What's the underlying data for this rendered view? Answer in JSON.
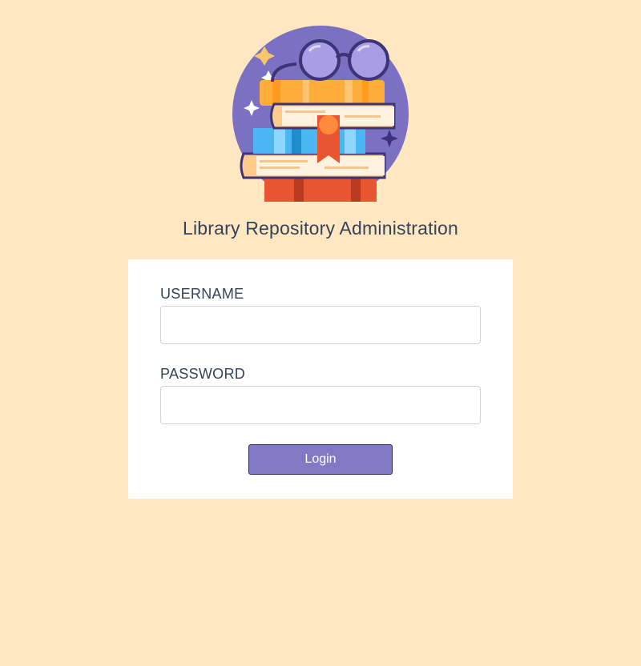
{
  "header": {
    "title": "Library Repository Administration",
    "logo_icon": "books-and-glasses-icon"
  },
  "login_form": {
    "username_label": "USERNAME",
    "username_value": "",
    "password_label": "PASSWORD",
    "password_value": "",
    "login_label": "Login"
  },
  "colors": {
    "background": "#ffe7c2",
    "card": "#ffffff",
    "title_text": "#34435a",
    "button": "#8179c3",
    "logo_circle": "#7b70c2"
  }
}
